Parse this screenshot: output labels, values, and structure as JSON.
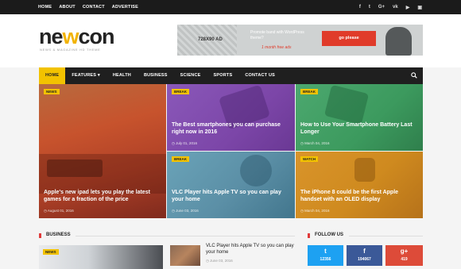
{
  "topnav": [
    "HOME",
    "ABOUT",
    "CONTACT",
    "ADVERTISE"
  ],
  "social_icons": [
    "facebook-icon",
    "twitter-icon",
    "google-plus-icon",
    "vk-icon",
    "youtube-icon",
    "instagram-icon"
  ],
  "social_glyphs": [
    "f",
    "t",
    "G+",
    "vk",
    "▶",
    "▣"
  ],
  "logo": {
    "part1": "ne",
    "w": "w",
    "part2": "con",
    "tagline": "NEWS & MAGAZINE HD THEME"
  },
  "ad": {
    "size": "728X90 AD",
    "promo": "Promote band with WordPress theme?",
    "price": "1 month free ads",
    "button": "go please"
  },
  "nav": {
    "items": [
      "HOME",
      "FEATURES ▾",
      "HEALTH",
      "BUSINESS",
      "SCIENCE",
      "SPORTS",
      "CONTACT US"
    ],
    "active_index": 0
  },
  "tiles": [
    {
      "badge": "NEWS",
      "title": "Apple's new ipad lets you play the latest games for a fraction of the price",
      "date": "◷ August 01, 2016"
    },
    {
      "badge": "BREAK",
      "title": "The Best smartphones you can purchase right now in 2016",
      "date": "◷ July 01, 2016"
    },
    {
      "badge": "BREAK",
      "title": "How to Use Your Smartphone Battery Last Longer",
      "date": "◷ March 04, 2016"
    },
    {
      "badge": "BREAK",
      "title": "VLC Player hits Apple TV so you can play your home",
      "date": "◷ June 03, 2016"
    },
    {
      "badge": "WATCH",
      "title": "The iPhone 8 could be the first Apple handset with an OLED display",
      "date": "◷ March 04, 2016"
    }
  ],
  "sections": {
    "business": "BUSINESS",
    "follow": "FOLLOW US"
  },
  "business": {
    "card_badge": "NEWS",
    "article_title": "VLC Player hits Apple TV so you can play your home",
    "article_date": "◷ June 03, 2016"
  },
  "follow": [
    {
      "icon": "twitter-icon",
      "glyph": "t",
      "count": "12356",
      "color": "#1da1f2"
    },
    {
      "icon": "facebook-icon",
      "glyph": "f",
      "count": "194067",
      "color": "#3b5998"
    },
    {
      "icon": "google-plus-icon",
      "glyph": "g+",
      "count": "419",
      "color": "#dd4b39"
    }
  ],
  "colors": {
    "accent": "#f2c200",
    "dark": "#1f1f1f",
    "section_bar": "#e03b3b"
  }
}
